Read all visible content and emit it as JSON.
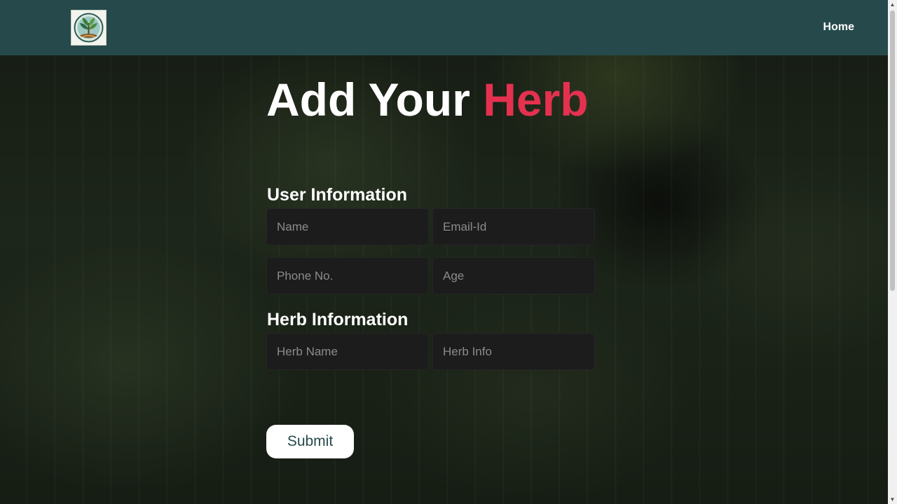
{
  "nav": {
    "home_label": "Home",
    "logo_icon": "herb-tree-logo-icon"
  },
  "page": {
    "title_main": "Add Your ",
    "title_accent": "Herb",
    "accent_color": "#e4314f",
    "navbar_color": "#264a4b"
  },
  "user_section": {
    "heading": "User Information",
    "fields": {
      "name_placeholder": "Name",
      "email_placeholder": "Email-Id",
      "phone_placeholder": "Phone No.",
      "age_placeholder": "Age"
    }
  },
  "herb_section": {
    "heading": "Herb Information",
    "fields": {
      "herb_name_placeholder": "Herb Name",
      "herb_info_placeholder": "Herb Info"
    }
  },
  "form": {
    "submit_label": "Submit"
  }
}
